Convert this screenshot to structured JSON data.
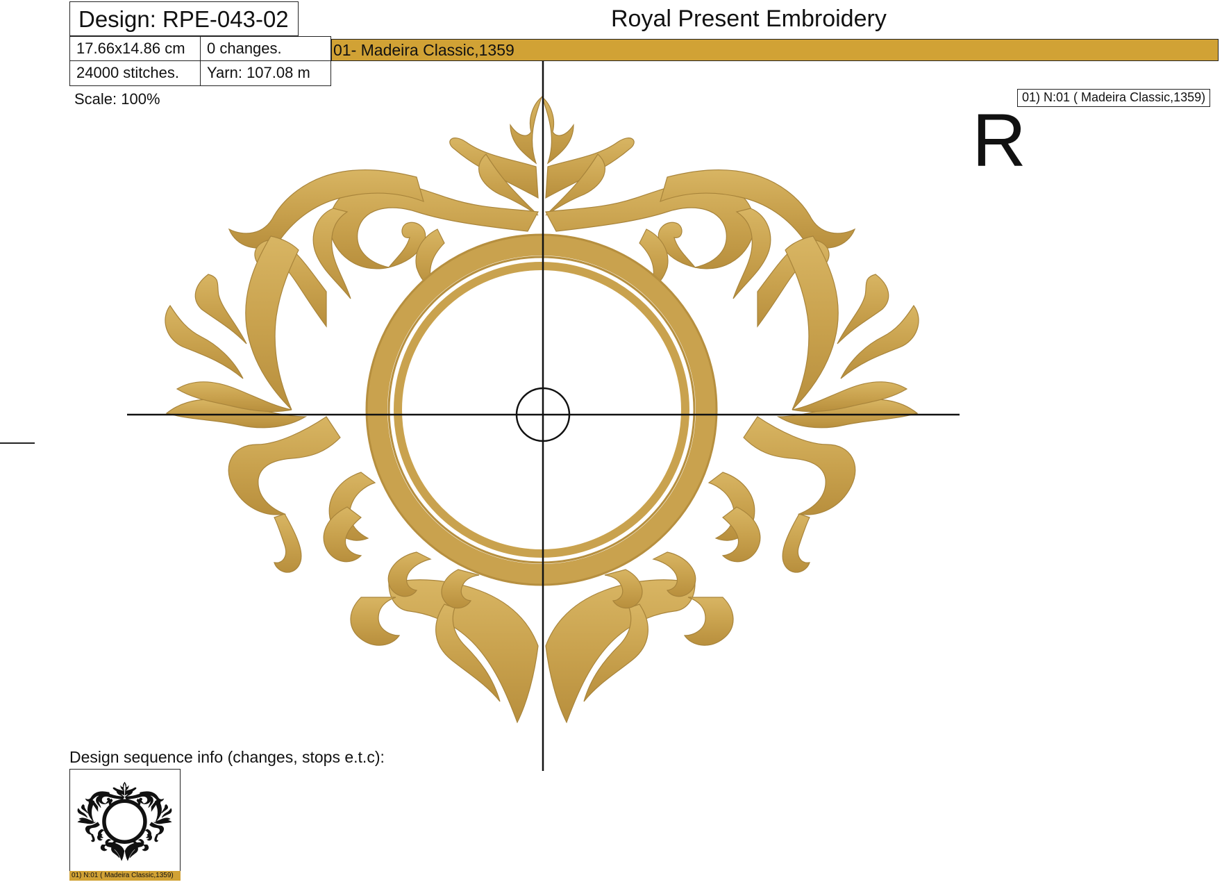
{
  "header": {
    "design_label": "Design: RPE-043-02",
    "size": "17.66x14.86 cm",
    "changes": "0 changes.",
    "stitches": "24000 stitches.",
    "yarn": "Yarn: 107.08 m",
    "company": "Royal Present Embroidery"
  },
  "thread": {
    "bar_label": "01- Madeira Classic,1359",
    "legend_label": "01) N:01 ( Madeira Classic,1359)",
    "color": "#d1a235"
  },
  "scale_label": "Scale: 100%",
  "orientation_mark": "R",
  "sequence": {
    "label": "Design sequence info (changes, stops e.t.c):",
    "thumb_caption": "01) N:01 ( Madeira Classic,1359)"
  },
  "colors": {
    "embroidery_gold": "#c9a24e",
    "embroidery_shadow": "#9c7a35",
    "thumbnail": "#111111"
  }
}
